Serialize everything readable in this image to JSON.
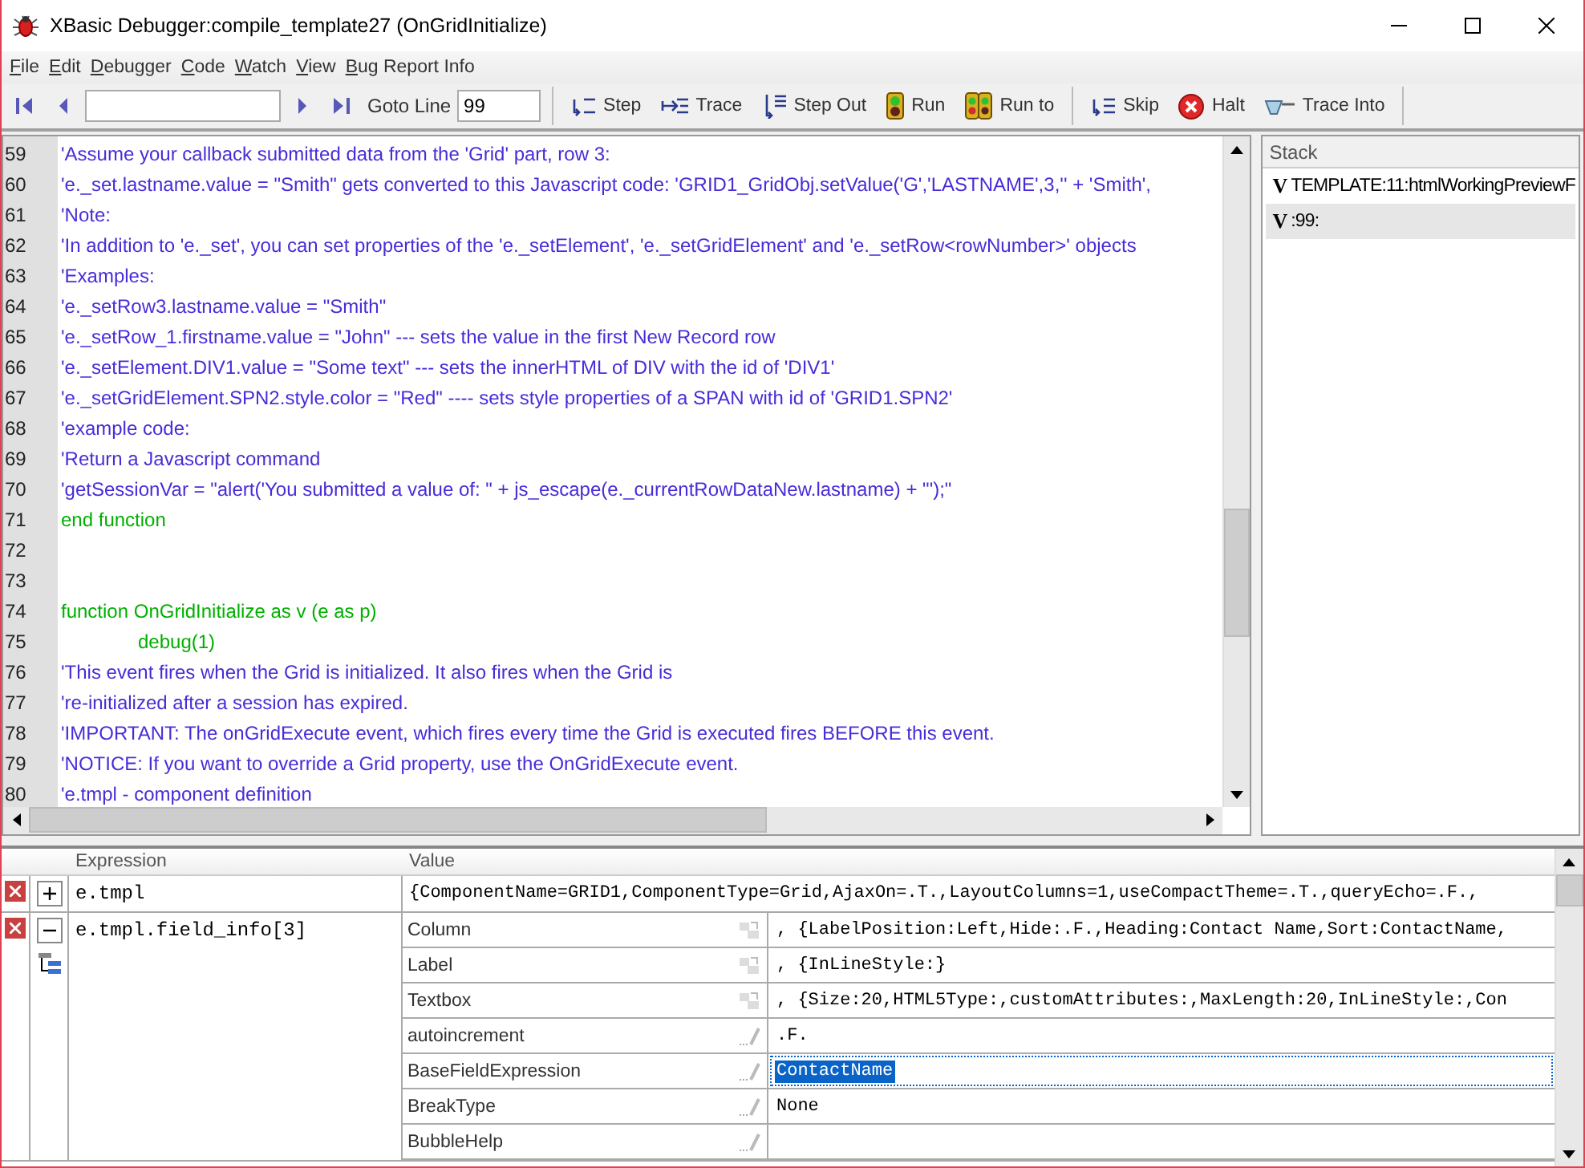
{
  "window": {
    "title": "XBasic Debugger:compile_template27 (OnGridInitialize)"
  },
  "menu": [
    "File",
    "Edit",
    "Debugger",
    "Code",
    "Watch",
    "View",
    "Bug Report Info"
  ],
  "toolbar": {
    "goto_label": "Goto Line",
    "goto_value": "99",
    "buttons": [
      {
        "kind": "step",
        "label": "Step"
      },
      {
        "kind": "trace",
        "label": "Trace"
      },
      {
        "kind": "stepout",
        "label": "Step Out"
      },
      {
        "kind": "run",
        "label": "Run"
      },
      {
        "kind": "runto",
        "label": "Run to"
      },
      {
        "kind": "skip",
        "label": "Skip"
      },
      {
        "kind": "halt",
        "label": "Halt"
      },
      {
        "kind": "traceinto",
        "label": "Trace Into"
      }
    ]
  },
  "code": {
    "lines": [
      {
        "number": "59",
        "kind": "comment",
        "text": "'Assume your callback submitted data from the 'Grid' part, row 3:"
      },
      {
        "number": "60",
        "kind": "comment",
        "text": "'e._set.lastname.value = \"Smith\" gets converted to this Javascript code: 'GRID1_GridObj.setValue('G','LASTNAME',3,'' + 'Smith',"
      },
      {
        "number": "61",
        "kind": "comment",
        "text": "'Note:"
      },
      {
        "number": "62",
        "kind": "comment",
        "text": "'In addition to 'e._set', you can set properties of the 'e._setElement', 'e._setGridElement' and 'e._setRow<rowNumber>' objects"
      },
      {
        "number": "63",
        "kind": "comment",
        "text": "'Examples:"
      },
      {
        "number": "64",
        "kind": "comment",
        "text": "'e._setRow3.lastname.value = \"Smith\""
      },
      {
        "number": "65",
        "kind": "comment",
        "text": "'e._setRow_1.firstname.value = \"John\" --- sets the value in the first New Record row"
      },
      {
        "number": "66",
        "kind": "comment",
        "text": "'e._setElement.DIV1.value = \"Some text\" --- sets the innerHTML of DIV with the id of 'DIV1'"
      },
      {
        "number": "67",
        "kind": "comment",
        "text": "'e._setGridElement.SPN2.style.color = \"Red\" ---- sets style properties of a SPAN with id of 'GRID1.SPN2'"
      },
      {
        "number": "68",
        "kind": "comment",
        "text": "'example code:"
      },
      {
        "number": "69",
        "kind": "comment",
        "text": "'Return a Javascript command"
      },
      {
        "number": "70",
        "kind": "comment",
        "text": "'getSessionVar = \"alert('You submitted a value of: \" + js_escape(e._currentRowDataNew.lastname) + \"');\""
      },
      {
        "number": "71",
        "kind": "code",
        "text": "end function"
      },
      {
        "number": "72",
        "kind": "blank"
      },
      {
        "number": "73",
        "kind": "blank"
      },
      {
        "number": "74",
        "kind": "code",
        "text": "function OnGridInitialize as v (e as p)"
      },
      {
        "number": "75",
        "kind": "code",
        "indented": true,
        "text": "debug(1)"
      },
      {
        "number": "76",
        "kind": "comment",
        "text": "'This event fires when the Grid is initialized. It also fires when the Grid is"
      },
      {
        "number": "77",
        "kind": "comment",
        "text": "'re-initialized after a session has expired."
      },
      {
        "number": "78",
        "kind": "comment",
        "text": "'IMPORTANT: The onGridExecute event, which fires every time the Grid is executed fires BEFORE this event."
      },
      {
        "number": "79",
        "kind": "comment",
        "text": "'NOTICE: If you want to override a Grid property, use the OnGridExecute event."
      },
      {
        "number": "80",
        "kind": "comment",
        "text": "'e.tmpl - component definition"
      }
    ]
  },
  "stack": {
    "title": "Stack",
    "items": [
      {
        "marker": "V",
        "text": "TEMPLATE:11:htmlWorkingPreviewF",
        "selected": false
      },
      {
        "marker": "V",
        "text": ":99:",
        "selected": true
      }
    ]
  },
  "watch": {
    "columns": [
      "Expression",
      "Value"
    ],
    "rows": [
      {
        "expression": "e.tmpl",
        "expanded": false,
        "value": "{ComponentName=GRID1,ComponentType=Grid,AjaxOn=.T.,LayoutColumns=1,useCompactTheme=.T.,queryEcho=.F.,"
      },
      {
        "expression": "e.tmpl.field_info[3]",
        "expanded": true,
        "properties": [
          {
            "name": "Column",
            "kind": "object",
            "value": ", {LabelPosition:Left,Hide:.F.,Heading:Contact Name,Sort:ContactName,",
            "selected": false
          },
          {
            "name": "Label",
            "kind": "object",
            "value": ", {InLineStyle:}",
            "selected": false
          },
          {
            "name": "Textbox",
            "kind": "object",
            "value": ", {Size:20,HTML5Type:,customAttributes:,MaxLength:20,InLineStyle:,Con",
            "selected": false
          },
          {
            "name": "autoincrement",
            "kind": "editable",
            "value": ".F.",
            "selected": false
          },
          {
            "name": "BaseFieldExpression",
            "kind": "editable",
            "value": "ContactName",
            "selected": true
          },
          {
            "name": "BreakType",
            "kind": "editable",
            "value": "None",
            "selected": false
          },
          {
            "name": "BubbleHelp",
            "kind": "editable",
            "selected": false
          }
        ]
      }
    ]
  }
}
